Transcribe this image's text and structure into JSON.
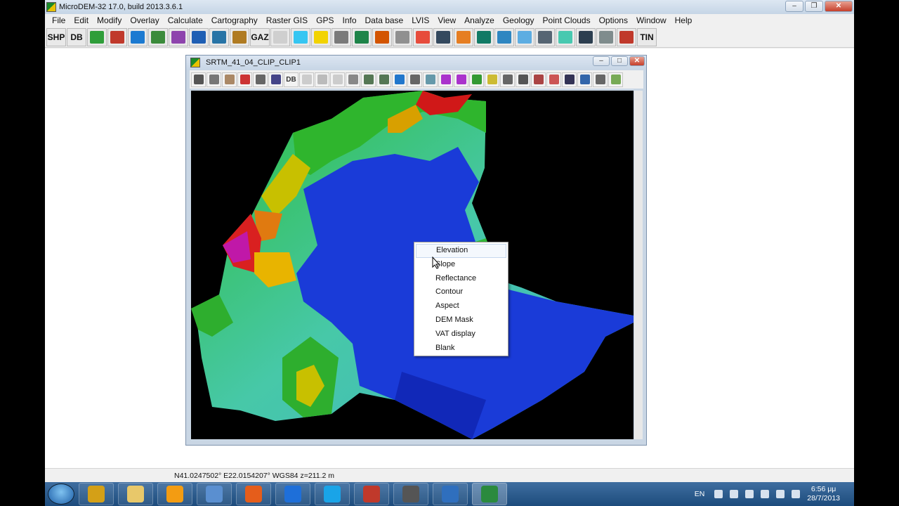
{
  "app": {
    "title": "MicroDEM-32 17.0, build 2013.3.6.1"
  },
  "menu": [
    "File",
    "Edit",
    "Modify",
    "Overlay",
    "Calculate",
    "Cartography",
    "Raster GIS",
    "GPS",
    "Info",
    "Data base",
    "LVIS",
    "View",
    "Analyze",
    "Geology",
    "Point Clouds",
    "Options",
    "Window",
    "Help"
  ],
  "toolbar": {
    "shp_label": "SHP",
    "db_label": "DB",
    "gaz_label": "GAZ",
    "tin_label": "TIN",
    "icons": [
      "map-open-icon",
      "dem-icon",
      "vector-icon",
      "terrain-icon",
      "grid-icon",
      "globe-icon",
      "world-icon",
      "field-guide-icon",
      "in-out-icon",
      "utm-icon",
      "sun-icon",
      "satellite-icon",
      "landsat-icon",
      "los-icon",
      "profile-icon",
      "rainbow-icon",
      "network-icon",
      "overlay-icon",
      "building-icon",
      "fly-icon",
      "fly2-icon",
      "opengl-icon",
      "surface-icon",
      "wire-globe-icon",
      "tetra-icon",
      "tern-icon"
    ],
    "icon_colors": [
      "#2f9e3a",
      "#c0392b",
      "#1c7ad1",
      "#3b8b3b",
      "#8e44ad",
      "#1f5fb4",
      "#2874a6",
      "#b07b22",
      "#cfcfcf",
      "#36c6f2",
      "#f2d300",
      "#7a7a7a",
      "#1e8449",
      "#d35400",
      "#909090",
      "#e74c3c",
      "#34495e",
      "#e67e22",
      "#117a65",
      "#2e86c1",
      "#5dade2",
      "#566573",
      "#48c9b0",
      "#2c3e50",
      "#7f8c8d",
      "#c0392b"
    ]
  },
  "map_window": {
    "title": "SRTM_41_04_CLIP_CLIP1",
    "toolbar_icons": [
      "print-icon",
      "copy-icon",
      "legend-icon",
      "redraw-icon",
      "subset-icon",
      "select-icon",
      "db-icon",
      "zoom-box-icon",
      "pan-icon",
      "crosshair-icon",
      "zoom-window-icon",
      "zoom-in-icon",
      "zoom-out-icon",
      "refresh-icon",
      "measure-icon",
      "profile-icon",
      "shape-icon",
      "peak-icon",
      "overlay-icon",
      "grid-icon",
      "target-icon",
      "graticule-icon",
      "duplicate-icon",
      "sample-icon",
      "pixel-icon",
      "web-icon",
      "help-icon",
      "extra-icon"
    ],
    "db_label": "DB"
  },
  "context_menu": {
    "items": [
      "Elevation",
      "Slope",
      "Reflectance",
      "Contour",
      "Aspect",
      "DEM Mask",
      "VAT display",
      "Blank"
    ]
  },
  "status": {
    "coords": "N41.0247502° E22.0154207°  WGS84 z=211.2 m"
  },
  "taskbar": {
    "apps": [
      "library-icon",
      "explorer-icon",
      "media-player-icon",
      "thunderbird-icon",
      "firefox-icon",
      "teamviewer-icon",
      "skype-icon",
      "filezilla-icon",
      "podcast-icon",
      "google-earth-icon",
      "microdem-icon"
    ],
    "app_colors": [
      "#d4a017",
      "#e8c86a",
      "#f39c12",
      "#5a8fd0",
      "#e55d1b",
      "#1e6fd9",
      "#19a4e8",
      "#c0392b",
      "#555",
      "#2f6fbe",
      "#2b8a3e"
    ]
  },
  "tray": {
    "language": "EN",
    "time": "6:56 μμ",
    "date": "28/7/2013"
  },
  "colors": {
    "titlebar": "#c8d6e6",
    "menu_bg": "#f0f0f0",
    "taskbar": "#1d4b7c"
  }
}
